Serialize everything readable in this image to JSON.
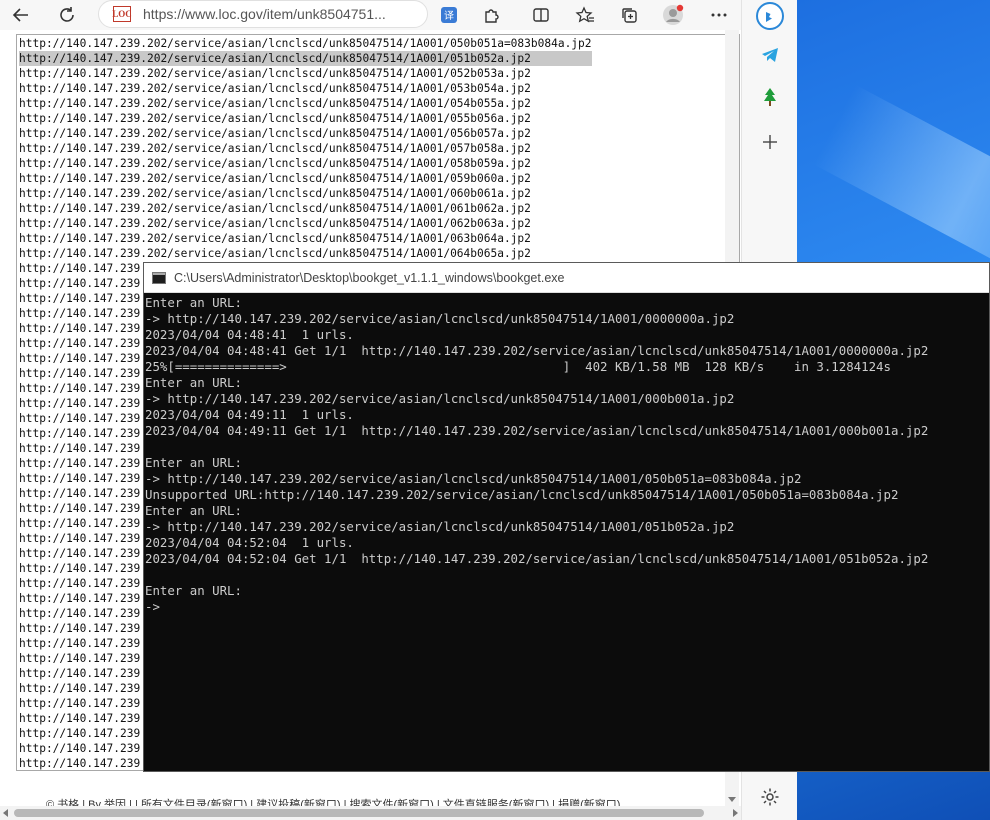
{
  "browser": {
    "url": "https://www.loc.gov/item/unk8504751...",
    "site_icon_text": "LOC"
  },
  "textbox": {
    "lines": [
      "http://140.147.239.202/service/asian/lcnclscd/unk85047514/1A001/050b051a=083b084a.jp2",
      "http://140.147.239.202/service/asian/lcnclscd/unk85047514/1A001/051b052a.jp2",
      "http://140.147.239.202/service/asian/lcnclscd/unk85047514/1A001/052b053a.jp2",
      "http://140.147.239.202/service/asian/lcnclscd/unk85047514/1A001/053b054a.jp2",
      "http://140.147.239.202/service/asian/lcnclscd/unk85047514/1A001/054b055a.jp2",
      "http://140.147.239.202/service/asian/lcnclscd/unk85047514/1A001/055b056a.jp2",
      "http://140.147.239.202/service/asian/lcnclscd/unk85047514/1A001/056b057a.jp2",
      "http://140.147.239.202/service/asian/lcnclscd/unk85047514/1A001/057b058a.jp2",
      "http://140.147.239.202/service/asian/lcnclscd/unk85047514/1A001/058b059a.jp2",
      "http://140.147.239.202/service/asian/lcnclscd/unk85047514/1A001/059b060a.jp2",
      "http://140.147.239.202/service/asian/lcnclscd/unk85047514/1A001/060b061a.jp2",
      "http://140.147.239.202/service/asian/lcnclscd/unk85047514/1A001/061b062a.jp2",
      "http://140.147.239.202/service/asian/lcnclscd/unk85047514/1A001/062b063a.jp2",
      "http://140.147.239.202/service/asian/lcnclscd/unk85047514/1A001/063b064a.jp2",
      "http://140.147.239.202/service/asian/lcnclscd/unk85047514/1A001/064b065a.jp2",
      "http://140.147.239",
      "http://140.147.239",
      "http://140.147.239",
      "http://140.147.239",
      "http://140.147.239",
      "http://140.147.239",
      "http://140.147.239",
      "http://140.147.239",
      "http://140.147.239",
      "http://140.147.239",
      "http://140.147.239",
      "http://140.147.239",
      "http://140.147.239",
      "http://140.147.239",
      "http://140.147.239",
      "http://140.147.239",
      "http://140.147.239",
      "http://140.147.239",
      "http://140.147.239",
      "http://140.147.239",
      "http://140.147.239",
      "http://140.147.239",
      "http://140.147.239",
      "http://140.147.239",
      "http://140.147.239",
      "http://140.147.239",
      "http://140.147.239",
      "http://140.147.239",
      "http://140.147.239",
      "http://140.147.239",
      "http://140.147.239",
      "http://140.147.239",
      "http://140.147.239",
      "http://140.147.239"
    ],
    "selected_index": 1
  },
  "footer": {
    "text": "© 书格 | By 举因 | | 所有文件目录(新窗口) | 建议投稿(新窗口) | 搜索文件(新窗口) | 文件直链服务(新窗口) | 捐赠(新窗口)"
  },
  "console": {
    "title": "C:\\Users\\Administrator\\Desktop\\bookget_v1.1.1_windows\\bookget.exe",
    "lines": [
      "Enter an URL:",
      "-> http://140.147.239.202/service/asian/lcnclscd/unk85047514/1A001/0000000a.jp2",
      "2023/04/04 04:48:41  1 urls.",
      "2023/04/04 04:48:41 Get 1/1  http://140.147.239.202/service/asian/lcnclscd/unk85047514/1A001/0000000a.jp2",
      "25%[==============>                                     ]  402 KB/1.58 MB  128 KB/s    in 3.1284124s",
      "Enter an URL:",
      "-> http://140.147.239.202/service/asian/lcnclscd/unk85047514/1A001/000b001a.jp2",
      "2023/04/04 04:49:11  1 urls.",
      "2023/04/04 04:49:11 Get 1/1  http://140.147.239.202/service/asian/lcnclscd/unk85047514/1A001/000b001a.jp2",
      "",
      "Enter an URL:",
      "-> http://140.147.239.202/service/asian/lcnclscd/unk85047514/1A001/050b051a=083b084a.jp2",
      "Unsupported URL:http://140.147.239.202/service/asian/lcnclscd/unk85047514/1A001/050b051a=083b084a.jp2",
      "Enter an URL:",
      "-> http://140.147.239.202/service/asian/lcnclscd/unk85047514/1A001/051b052a.jp2",
      "2023/04/04 04:52:04  1 urls.",
      "2023/04/04 04:52:04 Get 1/1  http://140.147.239.202/service/asian/lcnclscd/unk85047514/1A001/051b052a.jp2",
      "",
      "Enter an URL:",
      "->"
    ]
  },
  "icons": {
    "back": "back-arrow-icon",
    "refresh": "refresh-icon",
    "translate": "translate-icon",
    "extensions": "puzzle-icon",
    "split": "split-screen-icon",
    "favorites": "favorites-icon",
    "collections": "collections-icon",
    "profile": "profile-avatar-icon",
    "more": "more-icon",
    "bing": "bing-icon",
    "telegram": "telegram-icon",
    "tree": "tree-icon",
    "add": "plus-icon",
    "settings": "gear-icon"
  },
  "colors": {
    "console_bg": "#0c0c0c",
    "console_text": "#cccccc",
    "selection": "#c8c8c8",
    "desktop": "#1d6fe0"
  }
}
